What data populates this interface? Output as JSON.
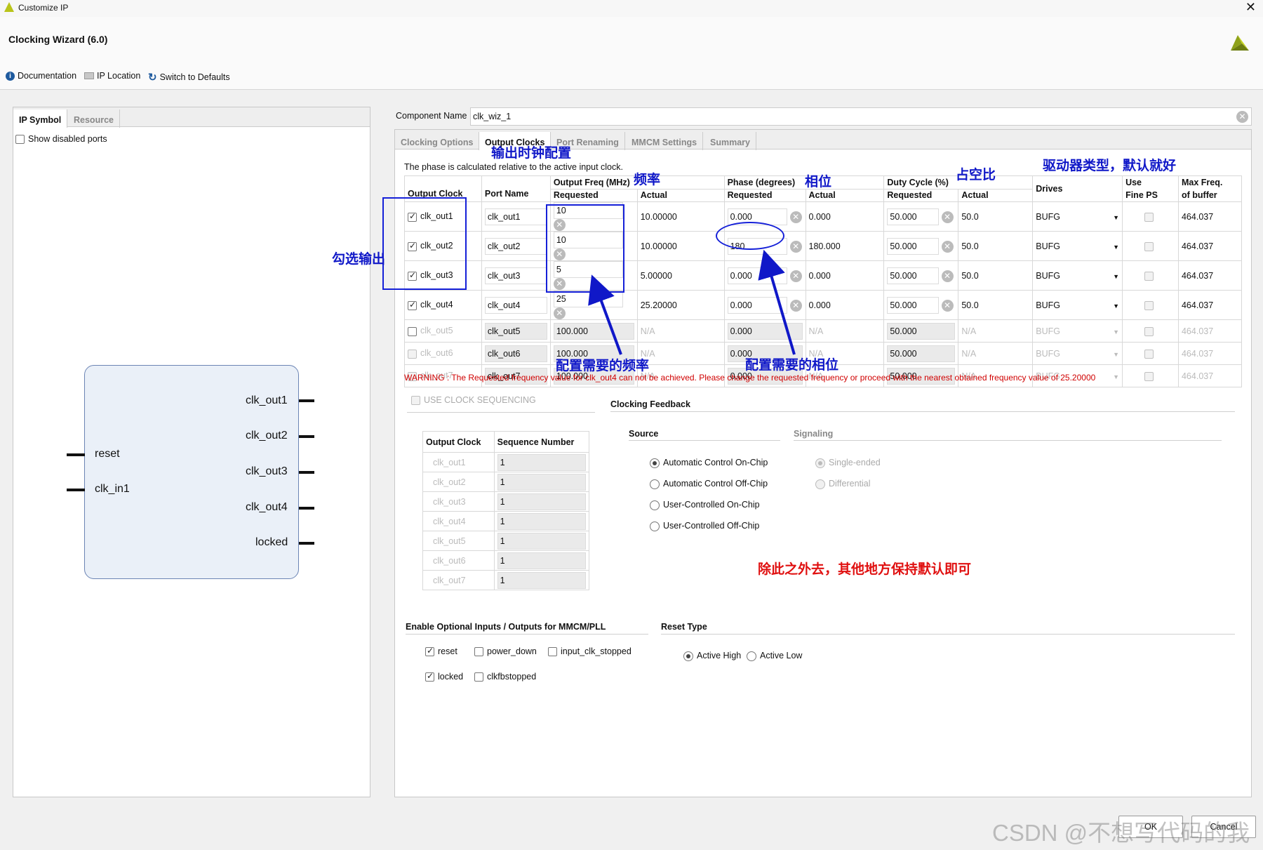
{
  "window": {
    "title": "Customize IP",
    "close_glyph": "✕"
  },
  "header": {
    "title": "Clocking Wizard (6.0)"
  },
  "toolbar": {
    "documentation": "Documentation",
    "ip_location": "IP Location",
    "switch_defaults": "Switch to Defaults"
  },
  "left_panel": {
    "tabs": [
      "IP Symbol",
      "Resource"
    ],
    "show_disabled_ports": "Show disabled ports",
    "symbol": {
      "inputs": [
        "reset",
        "clk_in1"
      ],
      "outputs": [
        "clk_out1",
        "clk_out2",
        "clk_out3",
        "clk_out4",
        "locked"
      ]
    }
  },
  "component": {
    "label": "Component Name",
    "value": "clk_wiz_1"
  },
  "tabs": [
    "Clocking Options",
    "Output Clocks",
    "Port Renaming",
    "MMCM Settings",
    "Summary"
  ],
  "output_clocks": {
    "phase_note": "The phase is calculated relative to the active input clock.",
    "headers": {
      "output_clock": "Output Clock",
      "port_name": "Port Name",
      "freq": "Output Freq (MHz)",
      "phase": "Phase (degrees)",
      "duty": "Duty Cycle (%)",
      "requested": "Requested",
      "actual": "Actual",
      "drives": "Drives",
      "use_line1": "Use",
      "use_line2": "Fine PS",
      "maxf_line1": "Max Freq.",
      "maxf_line2": "of buffer"
    },
    "rows": [
      {
        "name": "clk_out1",
        "checked": true,
        "port": "clk_out1",
        "freq_req": "10",
        "freq_act": "10.00000",
        "phase_req": "0.000",
        "phase_act": "0.000",
        "duty_req": "50.000",
        "duty_act": "50.0",
        "drives": "BUFG",
        "max_freq": "464.037"
      },
      {
        "name": "clk_out2",
        "checked": true,
        "port": "clk_out2",
        "freq_req": "10",
        "freq_act": "10.00000",
        "phase_req": "180",
        "phase_act": "180.000",
        "duty_req": "50.000",
        "duty_act": "50.0",
        "drives": "BUFG",
        "max_freq": "464.037"
      },
      {
        "name": "clk_out3",
        "checked": true,
        "port": "clk_out3",
        "freq_req": "5",
        "freq_act": "5.00000",
        "phase_req": "0.000",
        "phase_act": "0.000",
        "duty_req": "50.000",
        "duty_act": "50.0",
        "drives": "BUFG",
        "max_freq": "464.037"
      },
      {
        "name": "clk_out4",
        "checked": true,
        "port": "clk_out4",
        "freq_req": "25",
        "freq_act": "25.20000",
        "phase_req": "0.000",
        "phase_act": "0.000",
        "duty_req": "50.000",
        "duty_act": "50.0",
        "drives": "BUFG",
        "max_freq": "464.037"
      },
      {
        "name": "clk_out5",
        "checked": false,
        "port": "clk_out5",
        "freq_req": "100.000",
        "freq_act": "N/A",
        "phase_req": "0.000",
        "phase_act": "N/A",
        "duty_req": "50.000",
        "duty_act": "N/A",
        "drives": "BUFG",
        "max_freq": "464.037"
      },
      {
        "name": "clk_out6",
        "checked": false,
        "port": "clk_out6",
        "freq_req": "100.000",
        "freq_act": "N/A",
        "phase_req": "0.000",
        "phase_act": "N/A",
        "duty_req": "50.000",
        "duty_act": "N/A",
        "drives": "BUFG",
        "max_freq": "464.037"
      },
      {
        "name": "clk_out7",
        "checked": false,
        "port": "clk_out7",
        "freq_req": "100.000",
        "freq_act": "N/A",
        "phase_req": "0.000",
        "phase_act": "N/A",
        "duty_req": "50.000",
        "duty_act": "N/A",
        "drives": "BUFG",
        "max_freq": "464.037"
      }
    ],
    "warning": "WARNING : The Requested frequency value for clk_out4 can not be achieved. Please change the requested frequency or proceed with the nearest obtained frequency value of 25.20000"
  },
  "sequencing": {
    "label": "USE CLOCK SEQUENCING",
    "headers": [
      "Output Clock",
      "Sequence Number"
    ],
    "rows": [
      {
        "clk": "clk_out1",
        "num": "1"
      },
      {
        "clk": "clk_out2",
        "num": "1"
      },
      {
        "clk": "clk_out3",
        "num": "1"
      },
      {
        "clk": "clk_out4",
        "num": "1"
      },
      {
        "clk": "clk_out5",
        "num": "1"
      },
      {
        "clk": "clk_out6",
        "num": "1"
      },
      {
        "clk": "clk_out7",
        "num": "1"
      }
    ]
  },
  "feedback": {
    "title": "Clocking Feedback",
    "source": "Source",
    "signaling": "Signaling",
    "source_options": [
      "Automatic Control On-Chip",
      "Automatic Control Off-Chip",
      "User-Controlled On-Chip",
      "User-Controlled Off-Chip"
    ],
    "signaling_options": [
      "Single-ended",
      "Differential"
    ]
  },
  "optional_io": {
    "title": "Enable Optional Inputs / Outputs for MMCM/PLL",
    "options": [
      "reset",
      "power_down",
      "input_clk_stopped",
      "locked",
      "clkfbstopped"
    ]
  },
  "reset_type": {
    "title": "Reset Type",
    "options": [
      "Active High",
      "Active Low"
    ]
  },
  "buttons": {
    "ok": "OK",
    "cancel": "Cancel"
  },
  "annotations": {
    "output_cfg": "输出时钟配置",
    "freq": "频率",
    "phase": "相位",
    "duty": "占空比",
    "drives": "驱动器类型，默认就好",
    "select_output": "勾选输出",
    "cfg_freq": "配置需要的频率",
    "cfg_phase": "配置需要的相位",
    "others_default": "除此之外去，其他地方保持默认即可"
  },
  "watermark": "CSDN @不想写代码的我",
  "colors": {
    "annotation_blue": "#1018c8",
    "annotation_red": "#e01010",
    "warning_red": "#d00000"
  }
}
